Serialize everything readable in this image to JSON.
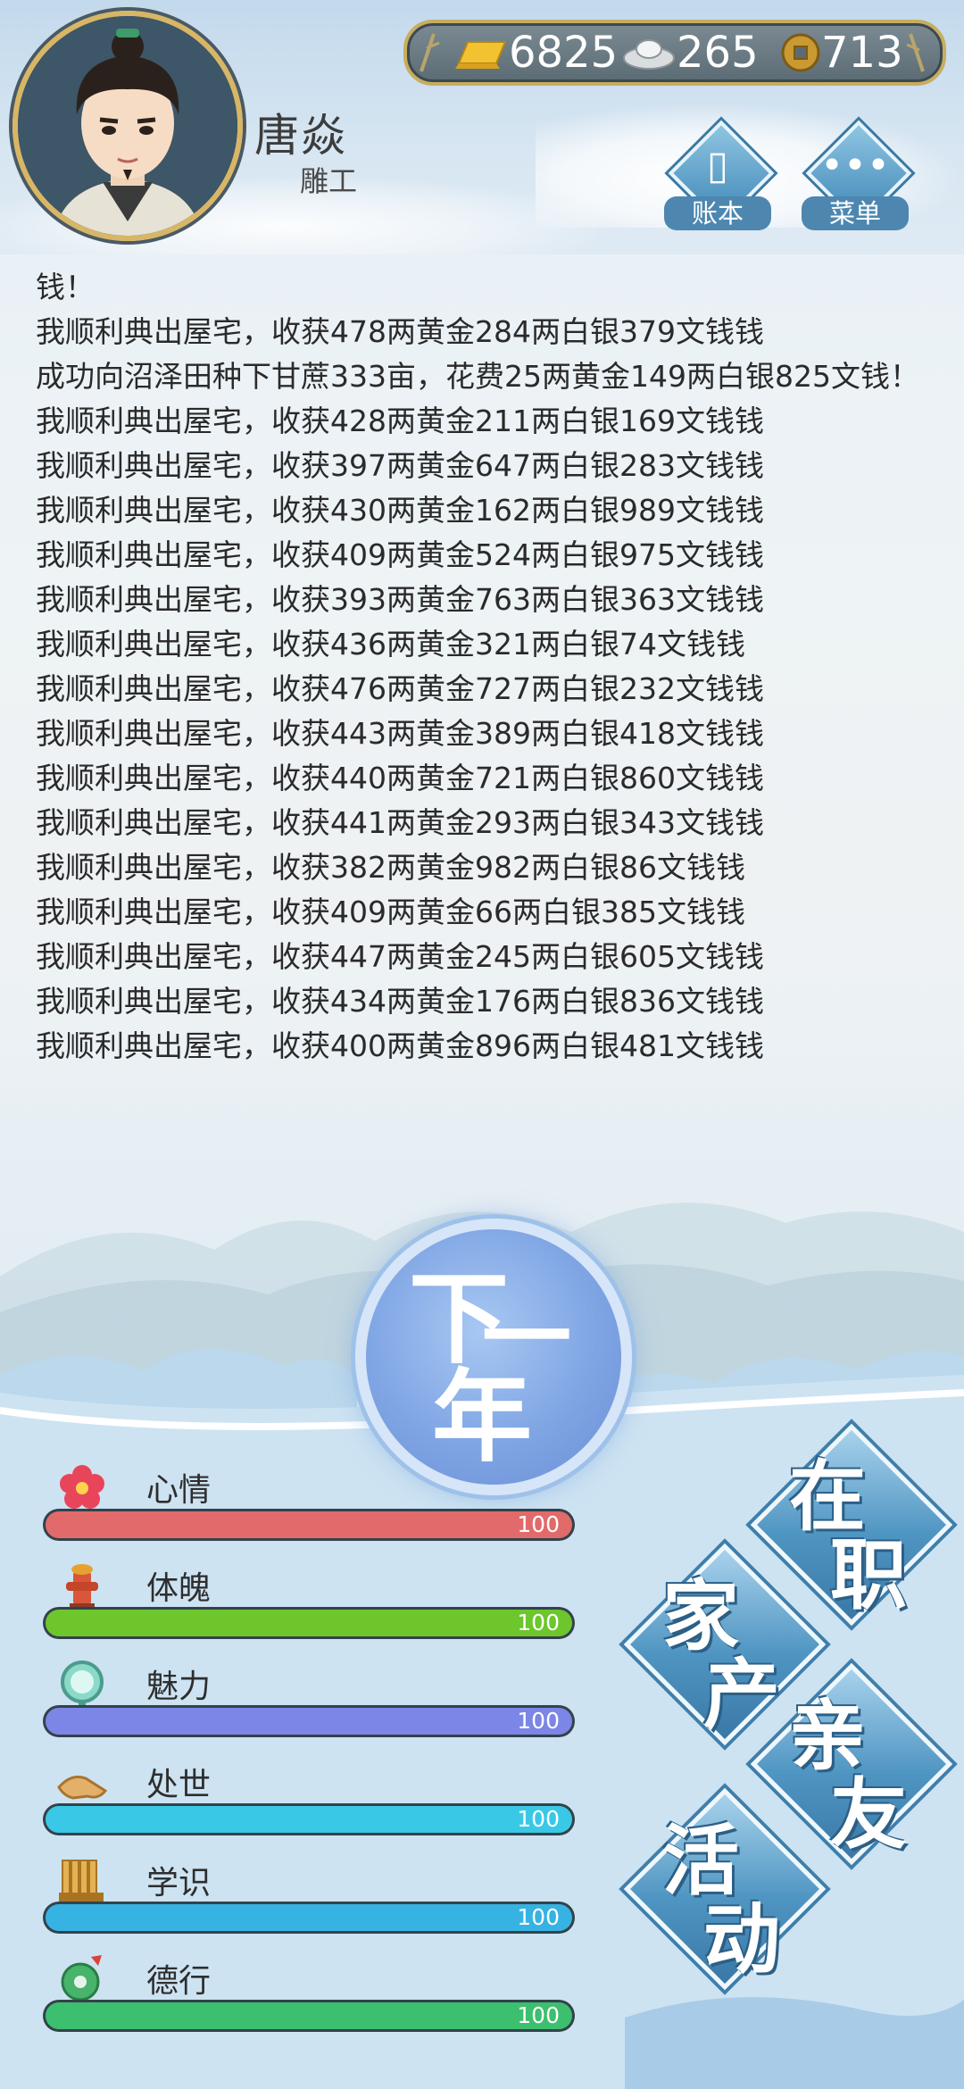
{
  "player": {
    "name": "唐焱",
    "job": "雕工"
  },
  "currency": {
    "gold": "6825",
    "silver": "265",
    "copper": "713"
  },
  "header_buttons": {
    "ledger": "账本",
    "menu": "菜单"
  },
  "log": [
    "钱！",
    "我顺利典出屋宅，收获478两黄金284两白银379文钱钱",
    "成功向沼泽田种下甘蔗333亩，花费25两黄金149两白银825文钱！",
    "我顺利典出屋宅，收获428两黄金211两白银169文钱钱",
    "我顺利典出屋宅，收获397两黄金647两白银283文钱钱",
    "我顺利典出屋宅，收获430两黄金162两白银989文钱钱",
    "我顺利典出屋宅，收获409两黄金524两白银975文钱钱",
    "我顺利典出屋宅，收获393两黄金763两白银363文钱钱",
    "我顺利典出屋宅，收获436两黄金321两白银74文钱钱",
    "我顺利典出屋宅，收获476两黄金727两白银232文钱钱",
    "我顺利典出屋宅，收获443两黄金389两白银418文钱钱",
    "我顺利典出屋宅，收获440两黄金721两白银860文钱钱",
    "我顺利典出屋宅，收获441两黄金293两白银343文钱钱",
    "我顺利典出屋宅，收获382两黄金982两白银86文钱钱",
    "我顺利典出屋宅，收获409两黄金66两白银385文钱钱",
    "我顺利典出屋宅，收获447两黄金245两白银605文钱钱",
    "我顺利典出屋宅，收获434两黄金176两白银836文钱钱",
    "我顺利典出屋宅，收获400两黄金896两白银481文钱钱"
  ],
  "next_year": {
    "c1": "下",
    "c2": "一",
    "c3": "年"
  },
  "stats": [
    {
      "name": "心情",
      "value": "100",
      "level": 1.0,
      "color": "#e26a6a",
      "icon": "flower-icon"
    },
    {
      "name": "体魄",
      "value": "100",
      "level": 1.0,
      "color": "#6cc62c",
      "icon": "fire-hydrant-icon"
    },
    {
      "name": "魅力",
      "value": "100",
      "level": 1.0,
      "color": "#7b86e6",
      "icon": "mirror-icon"
    },
    {
      "name": "处世",
      "value": "100",
      "level": 1.0,
      "color": "#39c9e6",
      "icon": "handshake-icon"
    },
    {
      "name": "学识",
      "value": "100",
      "level": 1.0,
      "color": "#36b3e2",
      "icon": "bamboo-scroll-icon"
    },
    {
      "name": "德行",
      "value": "100",
      "level": 1.0,
      "color": "#3cbf6e",
      "icon": "jade-icon"
    }
  ],
  "nav": {
    "zaizhi": {
      "c1": "在",
      "c2": "职"
    },
    "jiachan": {
      "c1": "家",
      "c2": "产"
    },
    "qinyou": {
      "c1": "亲",
      "c2": "友"
    },
    "huodong": {
      "c1": "活",
      "c2": "动"
    }
  }
}
